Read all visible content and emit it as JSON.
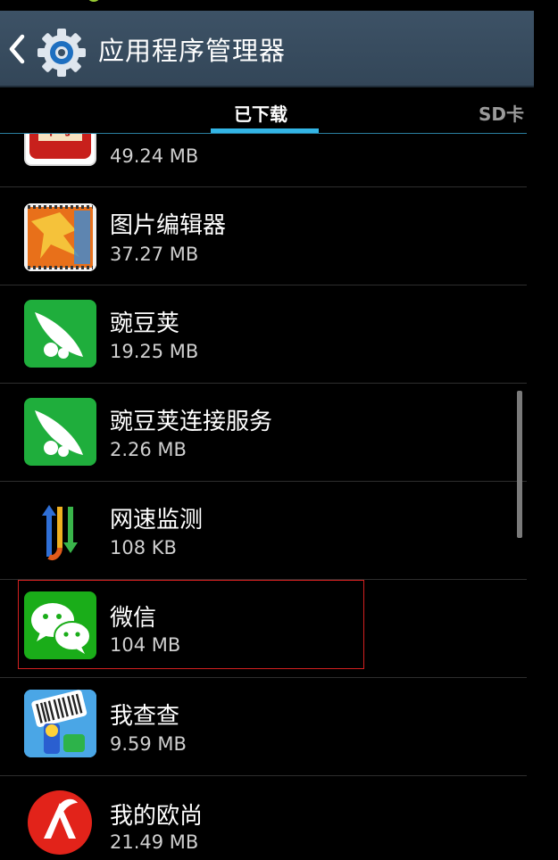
{
  "header": {
    "title": "应用程序管理器"
  },
  "tabs": [
    {
      "label": "已下载",
      "active": true
    },
    {
      "label": "SD卡",
      "active": false
    }
  ],
  "apps": [
    {
      "name": "",
      "size": "49.24 MB",
      "icon": "mahjong-icon"
    },
    {
      "name": "图片编辑器",
      "size": "37.27 MB",
      "icon": "photo-editor-icon"
    },
    {
      "name": "豌豆荚",
      "size": "19.25 MB",
      "icon": "wandoujia-icon"
    },
    {
      "name": "豌豆荚连接服务",
      "size": "2.26 MB",
      "icon": "wandoujia-connect-icon"
    },
    {
      "name": "网速监测",
      "size": "108 KB",
      "icon": "network-speed-icon"
    },
    {
      "name": "微信",
      "size": "104 MB",
      "icon": "wechat-icon",
      "selected": true
    },
    {
      "name": "我查查",
      "size": "9.59 MB",
      "icon": "barcode-scanner-icon"
    },
    {
      "name": "我的欧尚",
      "size": "21.49 MB",
      "icon": "auchan-icon"
    }
  ],
  "colors": {
    "accent": "#33b5e5",
    "actionbar": "#3a4f63",
    "wechat_green": "#1aad19",
    "selection": "#d32020"
  }
}
